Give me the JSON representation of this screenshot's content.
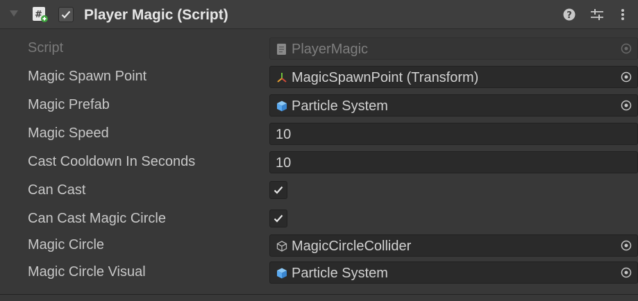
{
  "component": {
    "title": "Player Magic (Script)",
    "enabled": true,
    "icons": {
      "foldout": "foldout-arrow-icon",
      "script": "csharp-script-icon",
      "help": "help-icon",
      "presets": "presets-icon",
      "menu": "kebab-menu-icon"
    }
  },
  "fields": [
    {
      "label": "Script",
      "type": "object",
      "value": "PlayerMagic",
      "icon": "script-asset-icon",
      "disabled": true
    },
    {
      "label": "Magic Spawn Point",
      "type": "object",
      "value": "MagicSpawnPoint (Transform)",
      "icon": "transform-icon",
      "disabled": false
    },
    {
      "label": "Magic Prefab",
      "type": "object",
      "value": "Particle System",
      "icon": "prefab-cube-icon",
      "disabled": false
    },
    {
      "label": "Magic Speed",
      "type": "number",
      "value": "10"
    },
    {
      "label": "Cast Cooldown In Seconds",
      "type": "number",
      "value": "10"
    },
    {
      "label": "Can Cast",
      "type": "bool",
      "checked": true
    },
    {
      "label": "Can Cast Magic Circle",
      "type": "bool",
      "checked": true
    },
    {
      "label": "Magic Circle",
      "type": "object",
      "value": "MagicCircleCollider",
      "icon": "mesh-collider-icon",
      "disabled": false
    },
    {
      "label": "Magic Circle Visual",
      "type": "object",
      "value": "Particle System",
      "icon": "prefab-cube-icon",
      "disabled": false
    }
  ],
  "colors": {
    "background": "#383838",
    "header": "#3e3e3e",
    "field": "#2a2a2a",
    "prefab_blue": "#5aa9f0",
    "transform_orange": "#e8a030",
    "transform_green": "#6fbf3a"
  }
}
